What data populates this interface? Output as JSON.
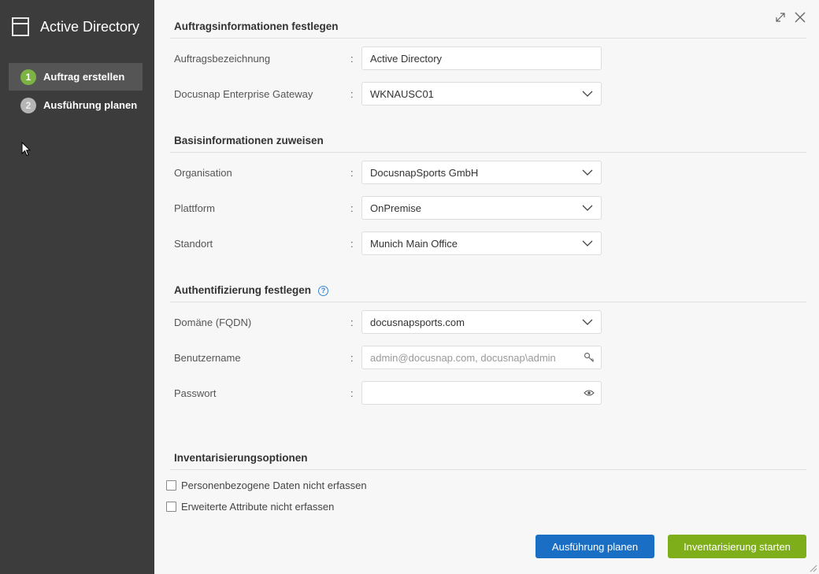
{
  "sidebar": {
    "title": "Active Directory",
    "steps": [
      {
        "number": "1",
        "label": "Auftrag erstellen",
        "state": "active"
      },
      {
        "number": "2",
        "label": "Ausführung planen",
        "state": "pending"
      }
    ]
  },
  "sections": {
    "job_info": "Auftragsinformationen festlegen",
    "base_info": "Basisinformationen zuweisen",
    "auth": "Authentifizierung festlegen",
    "inventory": "Inventarisierungsoptionen"
  },
  "fields": {
    "job_name": {
      "label": "Auftragsbezeichnung",
      "value": "Active Directory"
    },
    "gateway": {
      "label": "Docusnap Enterprise Gateway",
      "value": "WKNAUSC01"
    },
    "organisation": {
      "label": "Organisation",
      "value": "DocusnapSports GmbH"
    },
    "platform": {
      "label": "Plattform",
      "value": "OnPremise"
    },
    "location": {
      "label": "Standort",
      "value": "Munich Main Office"
    },
    "domain": {
      "label": "Domäne (FQDN)",
      "value": "docusnapsports.com"
    },
    "username": {
      "label": "Benutzername",
      "placeholder": "admin@docusnap.com, docusnap\\admin"
    },
    "password": {
      "label": "Passwort",
      "value": ""
    }
  },
  "colon": ":",
  "options": {
    "no_personal_data": {
      "label": "Personenbezogene Daten nicht erfassen",
      "checked": false
    },
    "no_extended_attrs": {
      "label": "Erweiterte Attribute nicht erfassen",
      "checked": false
    }
  },
  "buttons": {
    "schedule": "Ausführung planen",
    "start": "Inventarisierung starten"
  },
  "colors": {
    "sidebar_bg": "#3c3c3c",
    "active_step": "#7cb342",
    "primary_blue": "#1a6fc4",
    "primary_green": "#7fae1b"
  }
}
